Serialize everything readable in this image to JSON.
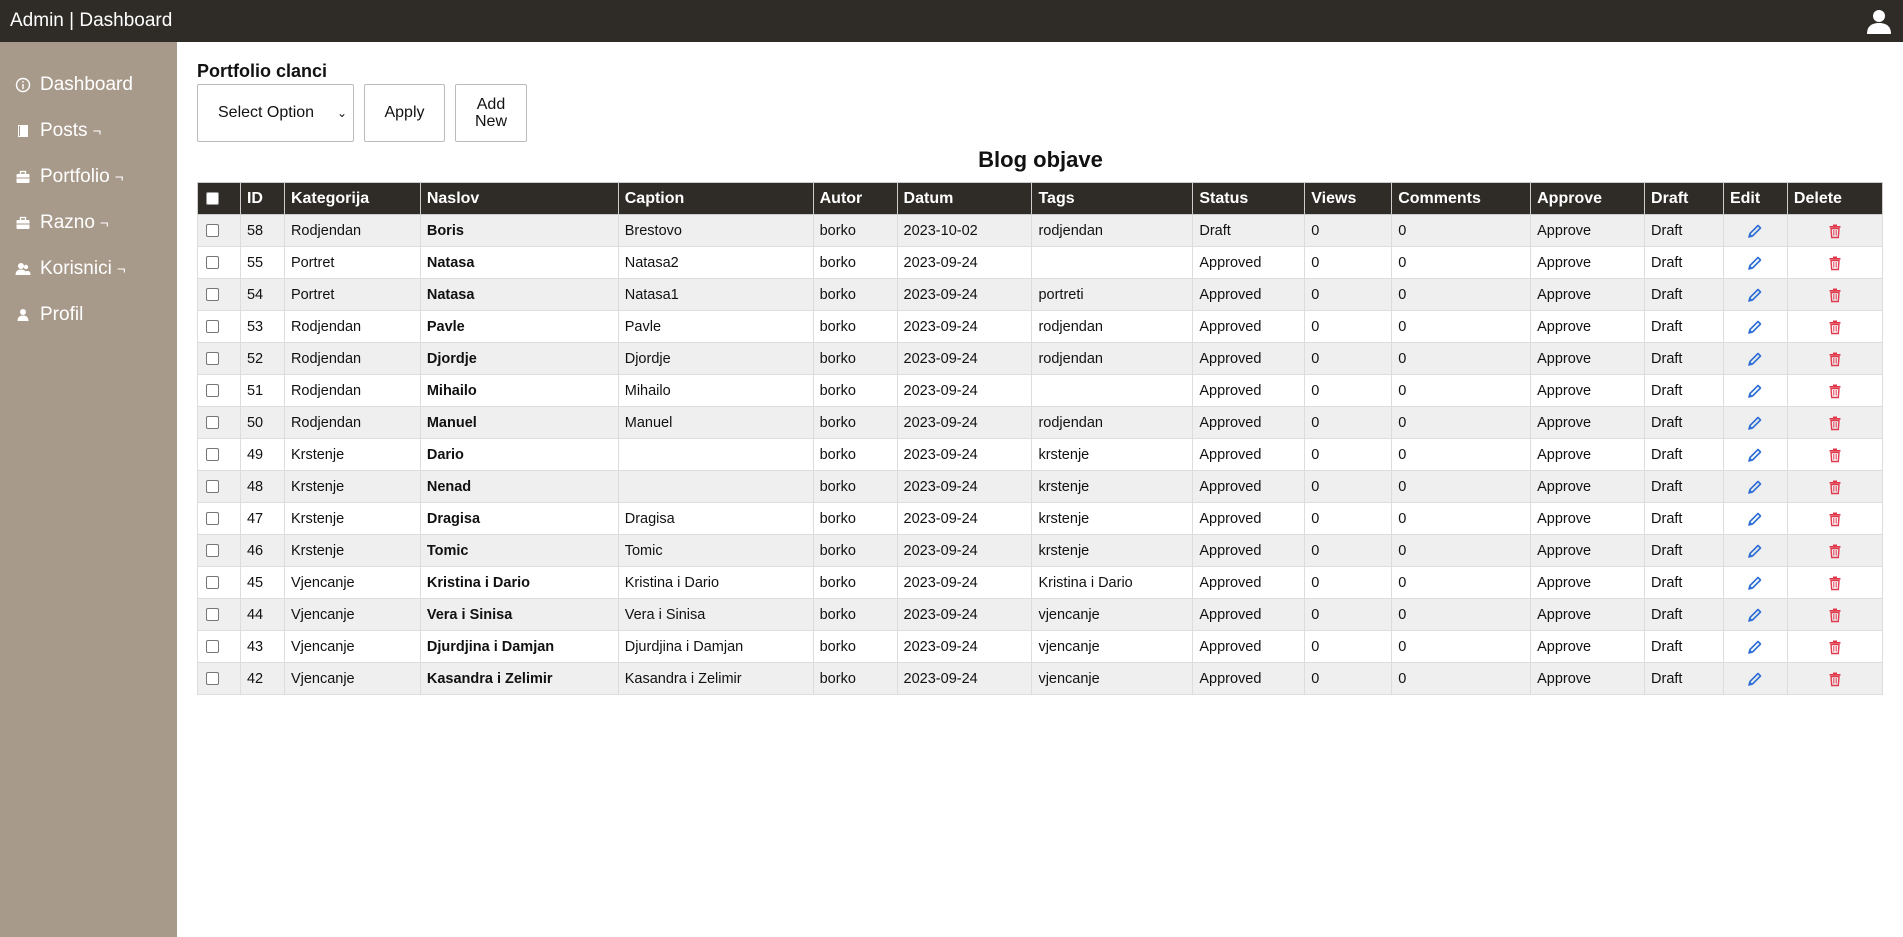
{
  "header": {
    "title": "Admin | Dashboard",
    "user_icon": "user-icon"
  },
  "sidebar": {
    "items": [
      {
        "label": "Dashboard",
        "icon": "info-icon",
        "arrow": ""
      },
      {
        "label": "Posts",
        "icon": "book-icon",
        "arrow": "¬"
      },
      {
        "label": "Portfolio",
        "icon": "briefcase-icon",
        "arrow": "¬"
      },
      {
        "label": "Razno",
        "icon": "briefcase-icon",
        "arrow": "¬"
      },
      {
        "label": "Korisnici",
        "icon": "users-icon",
        "arrow": "¬"
      },
      {
        "label": "Profil",
        "icon": "user-icon",
        "arrow": ""
      }
    ]
  },
  "main": {
    "section_title": "Portfolio clanci",
    "select_value": "Select Option",
    "apply_label": "Apply",
    "add_new_line1": "Add",
    "add_new_line2": "New",
    "table_title": "Blog objave"
  },
  "table": {
    "columns": [
      "ID",
      "Kategorija",
      "Naslov",
      "Caption",
      "Autor",
      "Datum",
      "Tags",
      "Status",
      "Views",
      "Comments",
      "Approve",
      "Draft",
      "Edit",
      "Delete"
    ],
    "rows": [
      {
        "id": "58",
        "kategorija": "Rodjendan",
        "naslov": "Boris",
        "caption": "Brestovo",
        "autor": "borko",
        "datum": "2023-10-02",
        "tags": "rodjendan",
        "status": "Draft",
        "views": "0",
        "comments": "0",
        "approve": "Approve",
        "draft": "Draft"
      },
      {
        "id": "55",
        "kategorija": "Portret",
        "naslov": "Natasa",
        "caption": "Natasa2",
        "autor": "borko",
        "datum": "2023-09-24",
        "tags": "",
        "status": "Approved",
        "views": "0",
        "comments": "0",
        "approve": "Approve",
        "draft": "Draft"
      },
      {
        "id": "54",
        "kategorija": "Portret",
        "naslov": "Natasa",
        "caption": "Natasa1",
        "autor": "borko",
        "datum": "2023-09-24",
        "tags": "portreti",
        "status": "Approved",
        "views": "0",
        "comments": "0",
        "approve": "Approve",
        "draft": "Draft"
      },
      {
        "id": "53",
        "kategorija": "Rodjendan",
        "naslov": "Pavle",
        "caption": "Pavle",
        "autor": "borko",
        "datum": "2023-09-24",
        "tags": "rodjendan",
        "status": "Approved",
        "views": "0",
        "comments": "0",
        "approve": "Approve",
        "draft": "Draft"
      },
      {
        "id": "52",
        "kategorija": "Rodjendan",
        "naslov": "Djordje",
        "caption": "Djordje",
        "autor": "borko",
        "datum": "2023-09-24",
        "tags": "rodjendan",
        "status": "Approved",
        "views": "0",
        "comments": "0",
        "approve": "Approve",
        "draft": "Draft"
      },
      {
        "id": "51",
        "kategorija": "Rodjendan",
        "naslov": "Mihailo",
        "caption": "Mihailo",
        "autor": "borko",
        "datum": "2023-09-24",
        "tags": "",
        "status": "Approved",
        "views": "0",
        "comments": "0",
        "approve": "Approve",
        "draft": "Draft"
      },
      {
        "id": "50",
        "kategorija": "Rodjendan",
        "naslov": "Manuel",
        "caption": "Manuel",
        "autor": "borko",
        "datum": "2023-09-24",
        "tags": "rodjendan",
        "status": "Approved",
        "views": "0",
        "comments": "0",
        "approve": "Approve",
        "draft": "Draft"
      },
      {
        "id": "49",
        "kategorija": "Krstenje",
        "naslov": "Dario",
        "caption": "",
        "autor": "borko",
        "datum": "2023-09-24",
        "tags": "krstenje",
        "status": "Approved",
        "views": "0",
        "comments": "0",
        "approve": "Approve",
        "draft": "Draft"
      },
      {
        "id": "48",
        "kategorija": "Krstenje",
        "naslov": "Nenad",
        "caption": "",
        "autor": "borko",
        "datum": "2023-09-24",
        "tags": "krstenje",
        "status": "Approved",
        "views": "0",
        "comments": "0",
        "approve": "Approve",
        "draft": "Draft"
      },
      {
        "id": "47",
        "kategorija": "Krstenje",
        "naslov": "Dragisa",
        "caption": "Dragisa",
        "autor": "borko",
        "datum": "2023-09-24",
        "tags": "krstenje",
        "status": "Approved",
        "views": "0",
        "comments": "0",
        "approve": "Approve",
        "draft": "Draft"
      },
      {
        "id": "46",
        "kategorija": "Krstenje",
        "naslov": "Tomic",
        "caption": "Tomic",
        "autor": "borko",
        "datum": "2023-09-24",
        "tags": "krstenje",
        "status": "Approved",
        "views": "0",
        "comments": "0",
        "approve": "Approve",
        "draft": "Draft"
      },
      {
        "id": "45",
        "kategorija": "Vjencanje",
        "naslov": "Kristina i Dario",
        "caption": "Kristina i Dario",
        "autor": "borko",
        "datum": "2023-09-24",
        "tags": "Kristina i Dario",
        "status": "Approved",
        "views": "0",
        "comments": "0",
        "approve": "Approve",
        "draft": "Draft"
      },
      {
        "id": "44",
        "kategorija": "Vjencanje",
        "naslov": "Vera i Sinisa",
        "caption": "Vera i Sinisa",
        "autor": "borko",
        "datum": "2023-09-24",
        "tags": "vjencanje",
        "status": "Approved",
        "views": "0",
        "comments": "0",
        "approve": "Approve",
        "draft": "Draft"
      },
      {
        "id": "43",
        "kategorija": "Vjencanje",
        "naslov": "Djurdjina i Damjan",
        "caption": "Djurdjina i Damjan",
        "autor": "borko",
        "datum": "2023-09-24",
        "tags": "vjencanje",
        "status": "Approved",
        "views": "0",
        "comments": "0",
        "approve": "Approve",
        "draft": "Draft"
      },
      {
        "id": "42",
        "kategorija": "Vjencanje",
        "naslov": "Kasandra i Zelimir",
        "caption": "Kasandra i Zelimir",
        "autor": "borko",
        "datum": "2023-09-24",
        "tags": "vjencanje",
        "status": "Approved",
        "views": "0",
        "comments": "0",
        "approve": "Approve",
        "draft": "Draft"
      }
    ],
    "edit_icon": "pencil-icon",
    "delete_icon": "trash-icon"
  },
  "colors": {
    "topbar": "#2f2b27",
    "sidebar": "#a89a8b",
    "edit": "#2f6fd6",
    "delete": "#e0394b",
    "row_alt": "#efefef"
  }
}
